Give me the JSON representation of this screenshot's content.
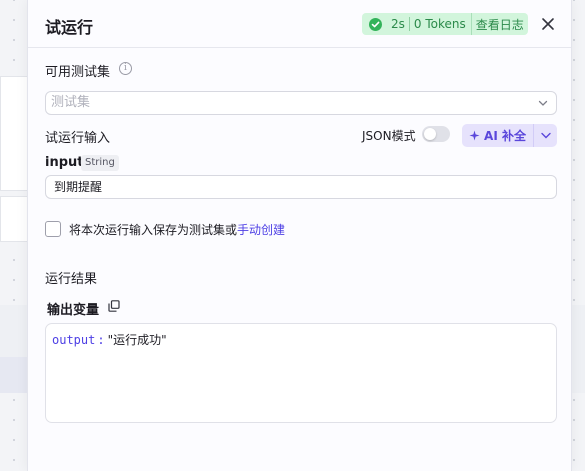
{
  "panel": {
    "title": "试运行",
    "status": {
      "duration": "2s",
      "tokens": "0 Tokens",
      "view_log": "查看日志",
      "color": "#33b35a"
    },
    "close_icon": "close-icon"
  },
  "testset": {
    "label": "可用测试集",
    "info_icon": "info-icon",
    "placeholder": "测试集"
  },
  "run_input": {
    "label": "试运行输入",
    "json_mode_label": "JSON模式",
    "json_mode_on": false,
    "ai_button_label": "AI 补全",
    "accent": "#5a46db",
    "field": {
      "name": "input",
      "type": "String",
      "value": "到期提醒"
    },
    "save_checkbox_text": "将本次运行输入保存为测试集或",
    "manual_create_link": "手动创建"
  },
  "result": {
    "section_label": "运行结果",
    "output_vars_label": "输出变量",
    "copy_icon": "copy-icon",
    "output_key": "output",
    "output_value": "\"运行成功\""
  }
}
